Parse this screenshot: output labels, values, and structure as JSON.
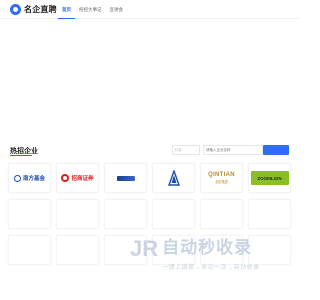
{
  "header": {
    "logo_text": "名企直聘",
    "nav": [
      "首页",
      "校招大事记",
      "宣讲会"
    ]
  },
  "section": {
    "title": "热招企业"
  },
  "filters": {
    "industry_placeholder": "行业",
    "search_placeholder": "请输入企业名称"
  },
  "companies": {
    "nanfang": "南方基金",
    "zhaoshang": "招商证券",
    "qintian": "QINTIAN",
    "qintian_sub": "全田集团",
    "zoomlion": "ZOOMLION"
  },
  "colors": {
    "accent": "#2f6df5",
    "watermark": "#c9d3e1"
  },
  "watermark": {
    "logo": "JR",
    "title": "自动秒收录",
    "subtitle": "一键上链接→来访一次→自动收录"
  }
}
